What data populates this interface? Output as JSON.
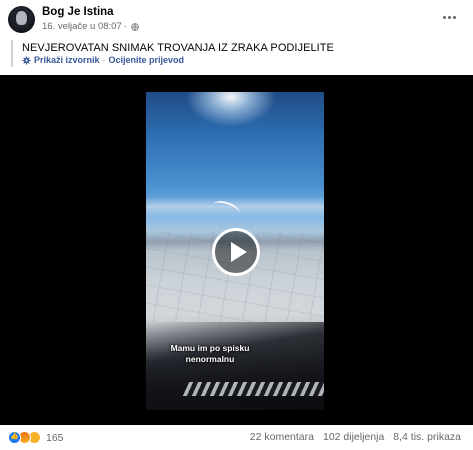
{
  "header": {
    "author": "Bog Je Istina",
    "timestamp": "16. veljače u 08:07",
    "separator": "·",
    "privacy_icon": "globe-icon",
    "more_icon": "more-options-icon"
  },
  "post": {
    "text": "NEVJEROVATAN SNIMAK TROVANJA IZ ZRAKA PODIJELITE",
    "translation": {
      "icon": "gear-icon",
      "show_source": "Prikaži izvornik",
      "separator": "·",
      "rate": "Ocijenite prijevod"
    }
  },
  "video": {
    "caption": "Mamu im po spisku nenormalnu",
    "play_icon": "play-icon"
  },
  "footer": {
    "reaction_icons": [
      "like-icon",
      "angry-icon",
      "sad-icon"
    ],
    "reaction_count": "165",
    "comments": "22 komentara",
    "shares": "102 dijeljenja",
    "views": "8,4 tis. prikaza"
  },
  "colors": {
    "link": "#385898",
    "secondary_text": "#65676b",
    "like_blue": "#1877f2"
  }
}
